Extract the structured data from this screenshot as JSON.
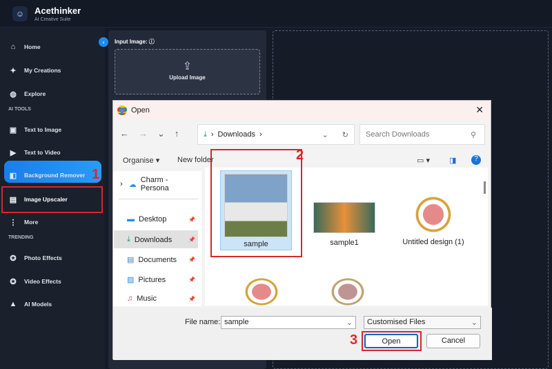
{
  "app": {
    "brand": "Acethinker",
    "subtitle": "AI Creative Suite"
  },
  "sidebar": {
    "items": [
      {
        "label": "Home",
        "icon": "home-icon"
      },
      {
        "label": "My Creations",
        "icon": "sparkle-icon"
      },
      {
        "label": "Explore",
        "icon": "globe-icon"
      }
    ],
    "ai_tools_header": "AI TOOLS",
    "tools": [
      {
        "label": "Text to Image"
      },
      {
        "label": "Text to Video"
      },
      {
        "label": "Background Remover"
      },
      {
        "label": "Image Upscaler",
        "active": true
      },
      {
        "label": "More"
      }
    ],
    "trending_header": "TRENDING",
    "trending": [
      {
        "label": "Photo Effects"
      },
      {
        "label": "Video Effects"
      },
      {
        "label": "AI Models"
      }
    ]
  },
  "panel": {
    "input_label": "Input Image:",
    "upload_label": "Upload Image"
  },
  "annotations": [
    "1",
    "2",
    "3"
  ],
  "accent": "#1d8cf0",
  "dialog": {
    "title": "Open",
    "path": "Downloads",
    "search_placeholder": "Search Downloads",
    "organise": "Organise ▾",
    "new_folder": "New folder",
    "nav": [
      "Charm - Persona",
      "Desktop",
      "Downloads",
      "Documents",
      "Pictures",
      "Music"
    ],
    "files": [
      "sample",
      "sample1",
      "Untitled design (1)",
      "",
      ""
    ],
    "filename_label": "File name:",
    "filename_value": "sample",
    "filetype": "Customised Files",
    "open": "Open",
    "cancel": "Cancel"
  }
}
